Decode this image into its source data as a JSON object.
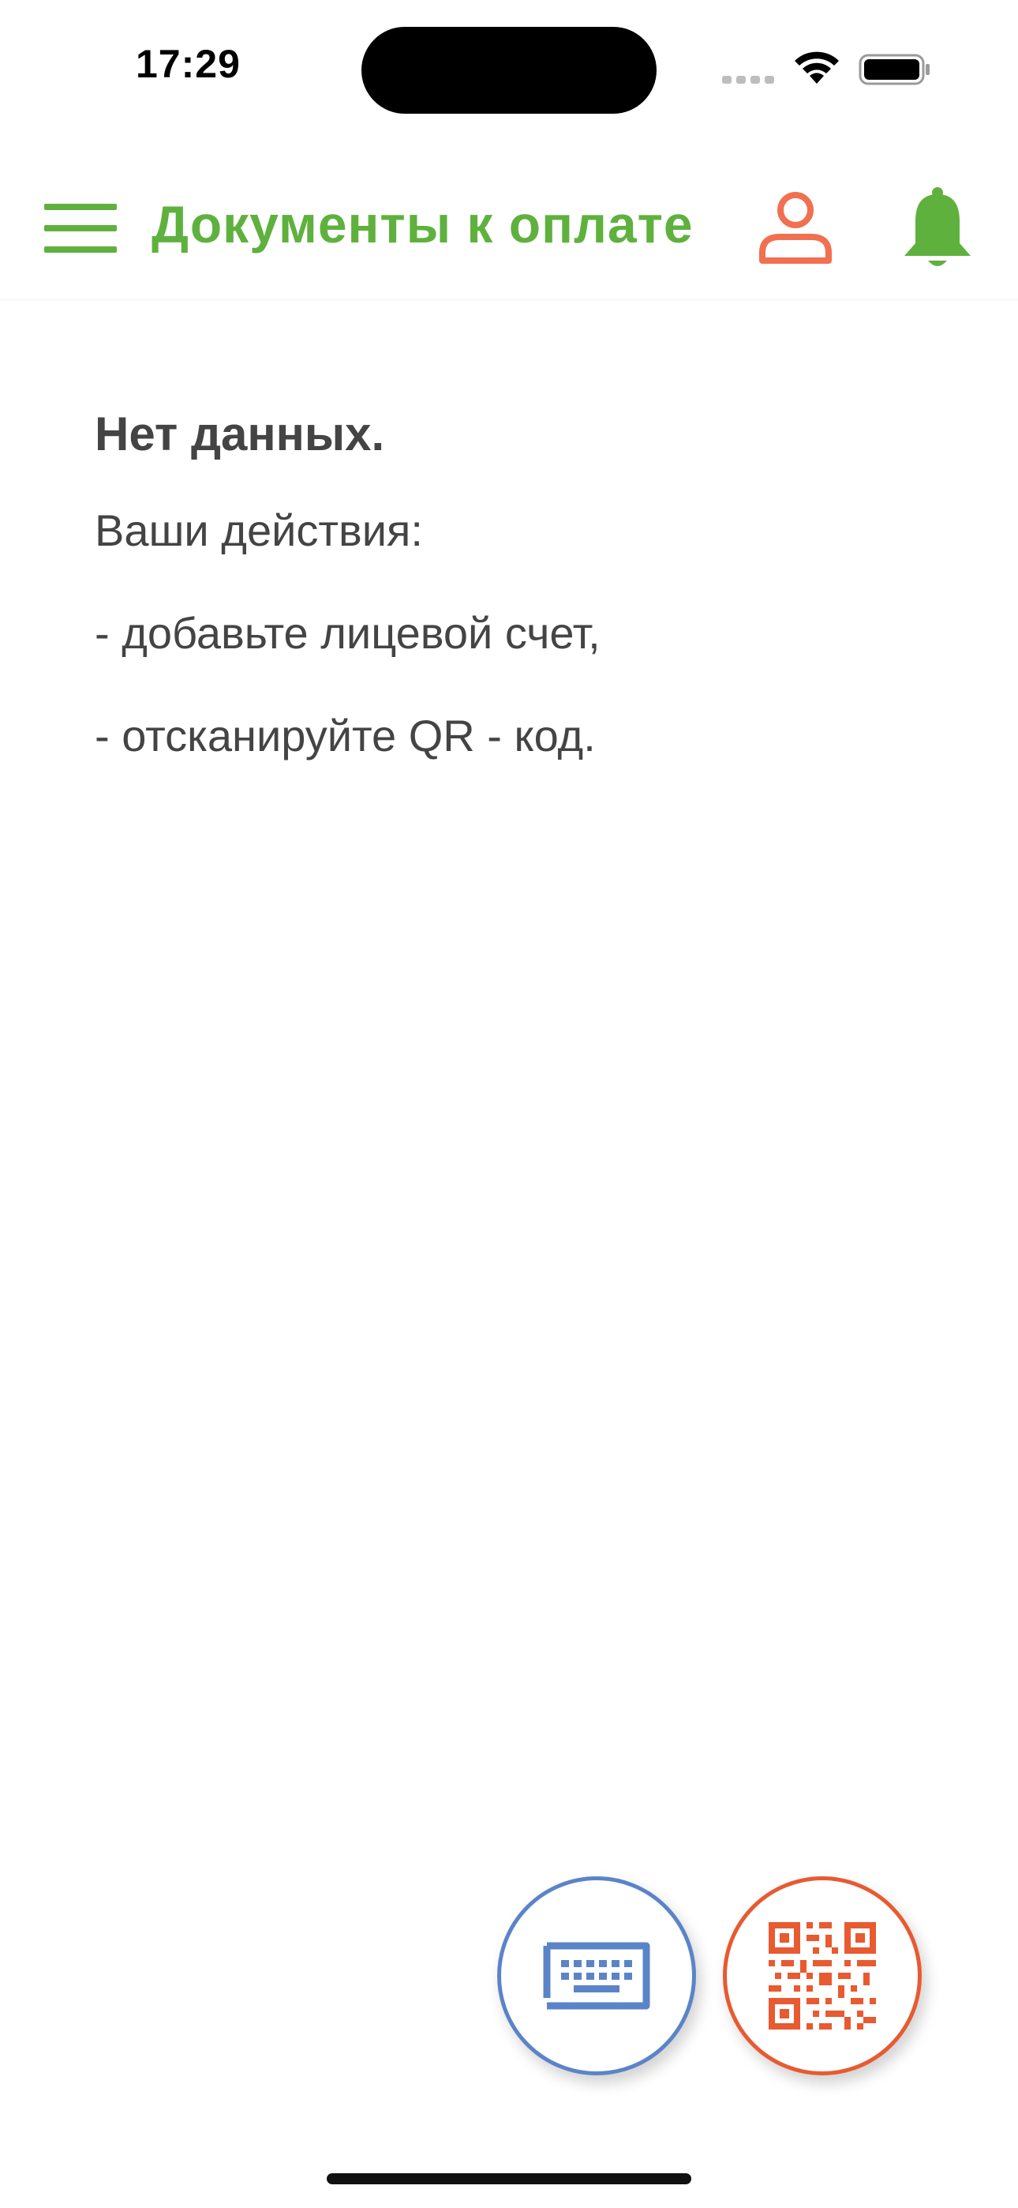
{
  "status_bar": {
    "time": "17:29",
    "icons": [
      "signal-icon",
      "wifi-icon",
      "battery-icon"
    ]
  },
  "header": {
    "title": "Документы к оплате",
    "icons": [
      "menu-icon",
      "user-icon",
      "bell-icon"
    ]
  },
  "empty_state": {
    "title": "Нет данных.",
    "lines": [
      "Ваши действия:",
      "- добавьте лицевой счет,",
      "- отсканируйте QR - код."
    ]
  },
  "actions": {
    "keyboard_button_icon": "keyboard-icon",
    "qr_button_icon": "qr-code-icon"
  },
  "colors": {
    "accent_green": "#5fb13e",
    "user_icon_orange": "#f07050",
    "keyboard_blue": "#5b84c8",
    "qr_orange": "#e85a30",
    "text": "#444444"
  }
}
